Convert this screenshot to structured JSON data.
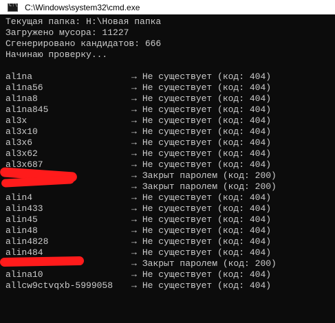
{
  "window": {
    "title": "C:\\Windows\\system32\\cmd.exe",
    "icon": "cmd-icon"
  },
  "console": {
    "header_lines": [
      "Текущая папка: H:\\Новая папка",
      "Загружено мусора: 11227",
      "Сгенерировано кандидатов: 666",
      "Начинаю проверку..."
    ],
    "arrow": "→",
    "results": [
      {
        "name": "al1na",
        "status": "Не существует (код: 404)"
      },
      {
        "name": "al1na56",
        "status": "Не существует (код: 404)"
      },
      {
        "name": "al1na8",
        "status": "Не существует (код: 404)"
      },
      {
        "name": "al1na845",
        "status": "Не существует (код: 404)"
      },
      {
        "name": "al3x",
        "status": "Не существует (код: 404)"
      },
      {
        "name": "al3x10",
        "status": "Не существует (код: 404)"
      },
      {
        "name": "al3x6",
        "status": "Не существует (код: 404)"
      },
      {
        "name": "al3x62",
        "status": "Не существует (код: 404)"
      },
      {
        "name": "al3x687",
        "status": "Не существует (код: 404)"
      },
      {
        "name": "",
        "status": "Закрыт паролем (код: 200)",
        "redacted": true
      },
      {
        "name": "",
        "status": "Закрыт паролем (код: 200)",
        "redacted": true
      },
      {
        "name": "alin4",
        "status": "Не существует (код: 404)"
      },
      {
        "name": "alin433",
        "status": "Не существует (код: 404)"
      },
      {
        "name": "alin45",
        "status": "Не существует (код: 404)"
      },
      {
        "name": "alin48",
        "status": "Не существует (код: 404)"
      },
      {
        "name": "alin4828",
        "status": "Не существует (код: 404)"
      },
      {
        "name": "alin484",
        "status": "Не существует (код: 404)"
      },
      {
        "name": "",
        "status": "Закрыт паролем (код: 200)",
        "redacted": true
      },
      {
        "name": "alina10",
        "status": "Не существует (код: 404)"
      },
      {
        "name": "allcw9ctvqxb-5999058",
        "status": "Не существует (код: 404)"
      }
    ]
  },
  "colors": {
    "console_bg": "#0c0c0c",
    "console_text": "#cccccc",
    "redaction": "#ff1b1b"
  }
}
